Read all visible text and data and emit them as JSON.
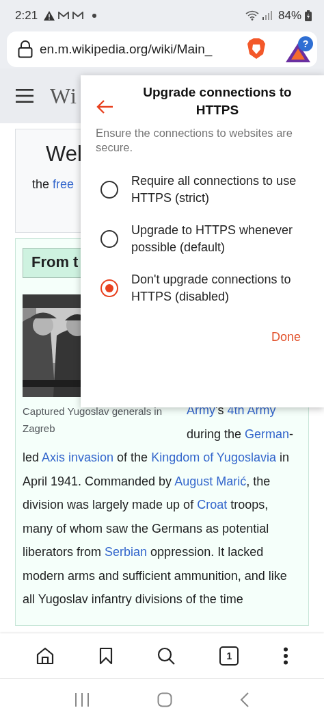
{
  "status_bar": {
    "time": "2:21",
    "battery": "84%"
  },
  "address_bar": {
    "url": "en.m.wikipedia.org/wiki/Main_",
    "badge": "?"
  },
  "page": {
    "logo": "Wi",
    "welcome": {
      "heading": "Wel",
      "segments": [
        {
          "text": "the ",
          "link": false
        },
        {
          "text": "free",
          "link": true
        }
      ]
    },
    "featured": {
      "heading": "From t",
      "caption": "Captured Yugoslav generals in Zagreb",
      "paragraph": [
        {
          "text": "Army",
          "link": true
        },
        {
          "text": "'s ",
          "link": false
        },
        {
          "text": "4th Army",
          "link": true
        },
        {
          "text": " during the ",
          "link": false
        },
        {
          "text": "German",
          "link": true
        },
        {
          "text": "-led ",
          "link": false
        },
        {
          "text": "Axis invasion",
          "link": true
        },
        {
          "text": " of the ",
          "link": false
        },
        {
          "text": "Kingdom ",
          "link": true
        },
        {
          "text": "of Yugoslavia",
          "link": true
        },
        {
          "text": " in April 1941. Commanded by ",
          "link": false
        },
        {
          "text": "August Marić",
          "link": true
        },
        {
          "text": ", the division was largely made up of ",
          "link": false
        },
        {
          "text": "Croat",
          "link": true
        },
        {
          "text": " troops, many of whom saw the Germans as potential liberators from ",
          "link": false
        },
        {
          "text": "Serbian",
          "link": true
        },
        {
          "text": " oppression. It lacked modern arms and sufficient ammunition, and like all Yugoslav infantry divisions of the time",
          "link": false
        }
      ]
    }
  },
  "dialog": {
    "title": "Upgrade connections to HTTPS",
    "description": "Ensure the connections to websites are secure.",
    "options": [
      {
        "label": "Require all connections to use HTTPS (strict)",
        "selected": false
      },
      {
        "label": "Upgrade to HTTPS whenever possible (default)",
        "selected": false
      },
      {
        "label": "Don't upgrade connections to HTTPS (disabled)",
        "selected": true
      }
    ],
    "done": "Done"
  },
  "bottom_bar": {
    "tab_count": "1"
  }
}
